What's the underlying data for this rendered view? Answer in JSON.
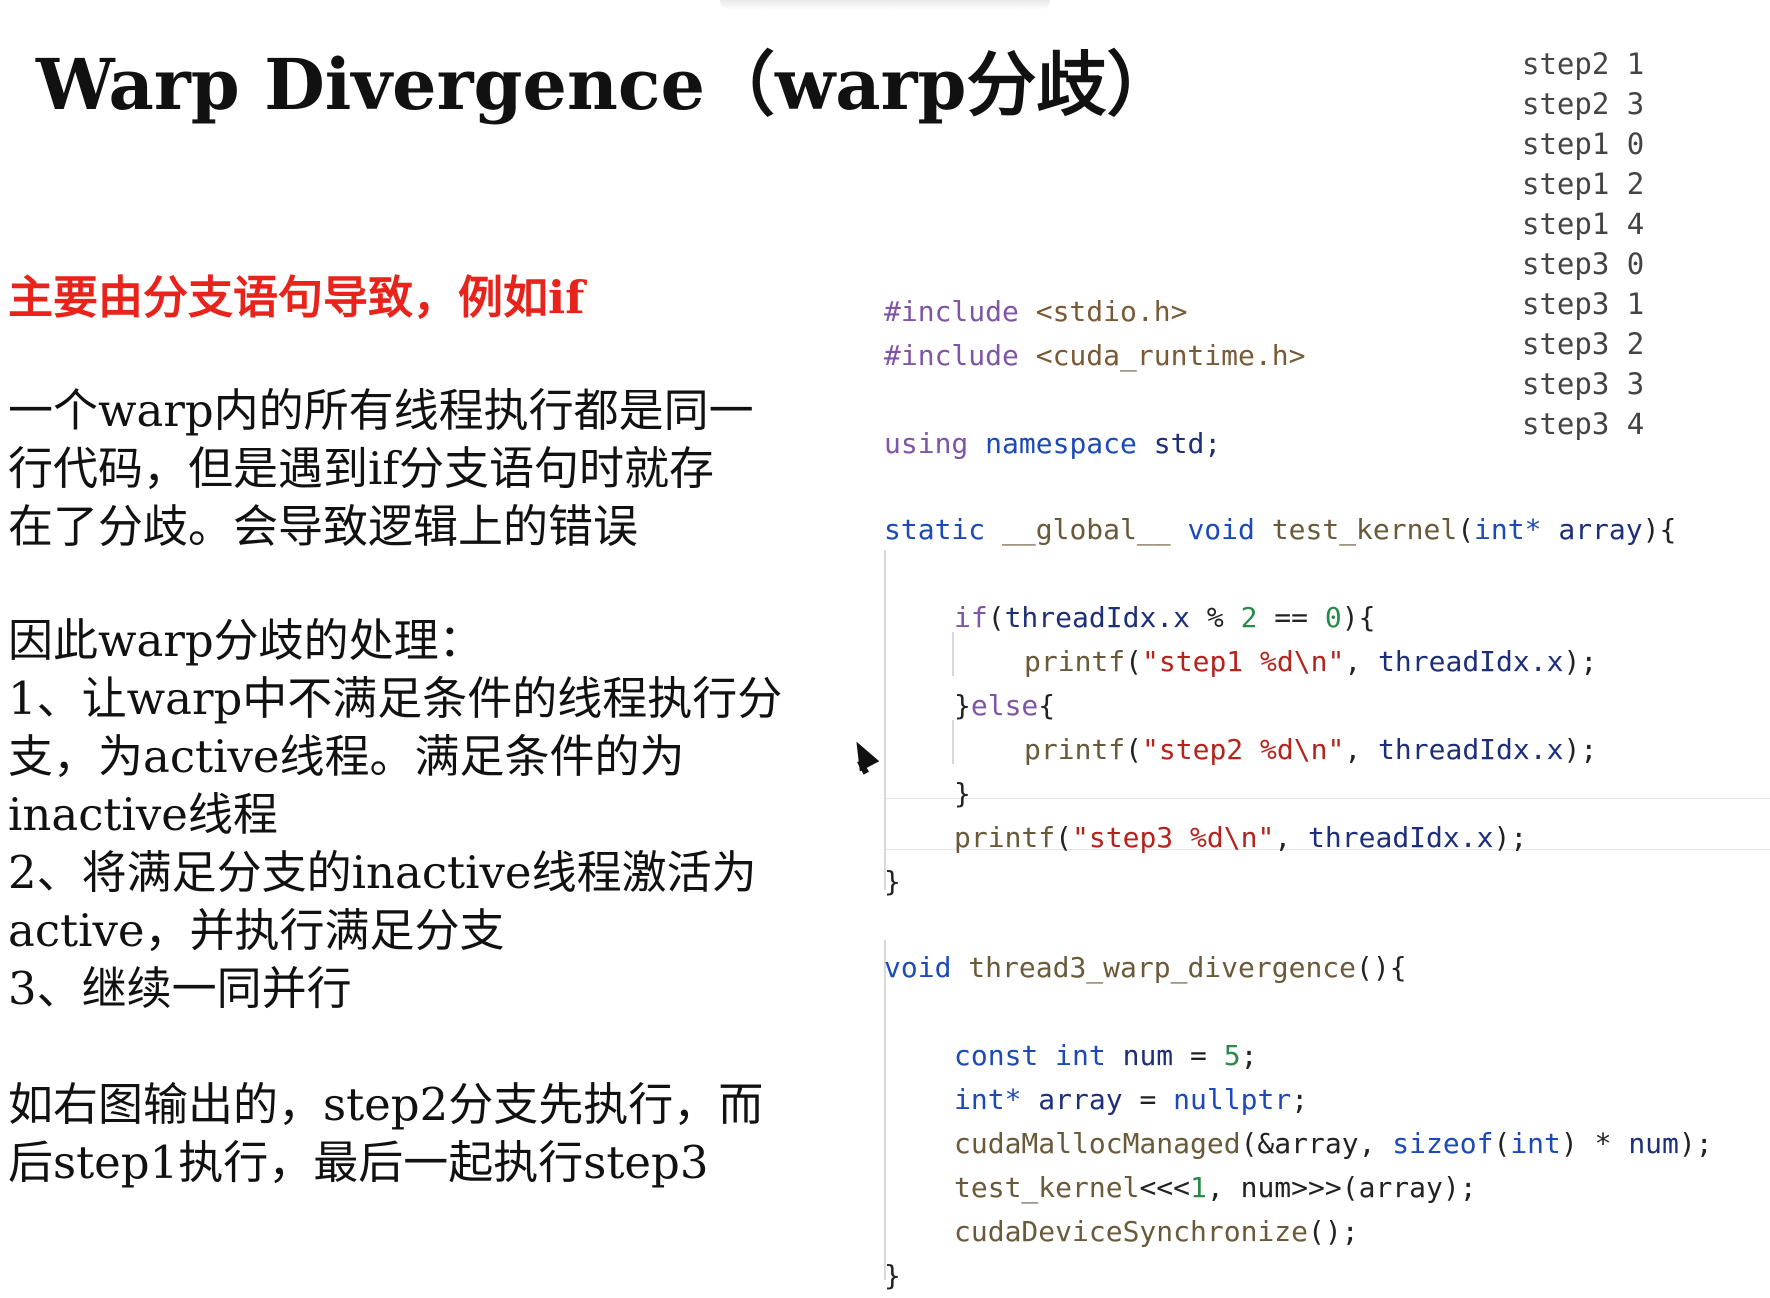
{
  "title": "Warp Divergence（warp分歧）",
  "subtitle": "主要由分支语句导致，例如if",
  "paragraph1": [
    "一个warp内的所有线程执行都是同一",
    "行代码，但是遇到if分支语句时就存",
    "在了分歧。会导致逻辑上的错误"
  ],
  "paragraph2": [
    "因此warp分歧的处理：",
    "1、让warp中不满足条件的线程执行分",
    "支，为active线程。满足条件的为",
    "inactive线程",
    "2、将满足分支的inactive线程激活为",
    "active，并执行满足分支",
    "3、继续一同并行"
  ],
  "paragraph3": [
    "如右图输出的，step2分支先执行，而",
    "后step1执行，最后一起执行step3"
  ],
  "output": [
    "step2 1",
    "step2 3",
    "step1 0",
    "step1 2",
    "step1 4",
    "step3 0",
    "step3 1",
    "step3 2",
    "step3 3",
    "step3 4"
  ],
  "code": {
    "include1_kw": "#include",
    "include1_file": "<stdio.h>",
    "include2_kw": "#include",
    "include2_file": "<cuda_runtime.h>",
    "using_kw": "using",
    "namespace_kw": "namespace",
    "std": "std;",
    "static_kw": "static",
    "global_kw": "__global__",
    "void_kw": "void",
    "kernel_name": "test_kernel",
    "kernel_params_open": "(",
    "int_kw": "int*",
    "array_param": "array",
    "kernel_params_close": "){",
    "if_kw": "if",
    "if_open": "(",
    "thread_idx1": "threadIdx.x",
    "mod_op": " % ",
    "two": "2",
    "eq_op": " == ",
    "zero": "0",
    "if_close": "){",
    "printf1": "printf",
    "p_open1": "(",
    "str1": "\"step1 %d\\n\"",
    "comma1": ", ",
    "thread_idx2": "threadIdx.x",
    "p_close1": ");",
    "else_close_brace": "}",
    "else_kw": "else",
    "else_open": "{",
    "printf2": "printf",
    "p_open2": "(",
    "str2": "\"step2 %d\\n\"",
    "comma2": ", ",
    "thread_idx3": "threadIdx.x",
    "p_close2": ");",
    "inner_close": "}",
    "printf3": "printf",
    "p_open3": "(",
    "str3": "\"step3 %d\\n\"",
    "comma3": ", ",
    "thread_idx4": "threadIdx.x",
    "p_close3": ");",
    "kernel_close": "}",
    "void2_kw": "void",
    "main_func": "thread3_warp_divergence",
    "main_open": "(){",
    "const_kw": "const",
    "int2_kw": "int",
    "num_var": "num",
    "assign1": " = ",
    "five": "5",
    "semi1": ";",
    "int3_kw": "int*",
    "array_var": "array",
    "assign2": " = ",
    "nullptr_kw": "nullptr",
    "semi2": ";",
    "malloc_fn": "cudaMallocManaged",
    "malloc_args1": "(&array, ",
    "sizeof_kw": "sizeof",
    "malloc_args2": "(",
    "int4_kw": "int",
    "malloc_args3": ") ",
    "star": "*",
    "num_arg": " num",
    "malloc_end": ");",
    "launch_fn": "test_kernel",
    "launch_open": "<<<",
    "one": "1",
    "launch_args": ", num>>>",
    "launch_end": "(array);",
    "sync_fn": "cudaDeviceSynchronize",
    "sync_end": "();",
    "main_close": "}"
  }
}
